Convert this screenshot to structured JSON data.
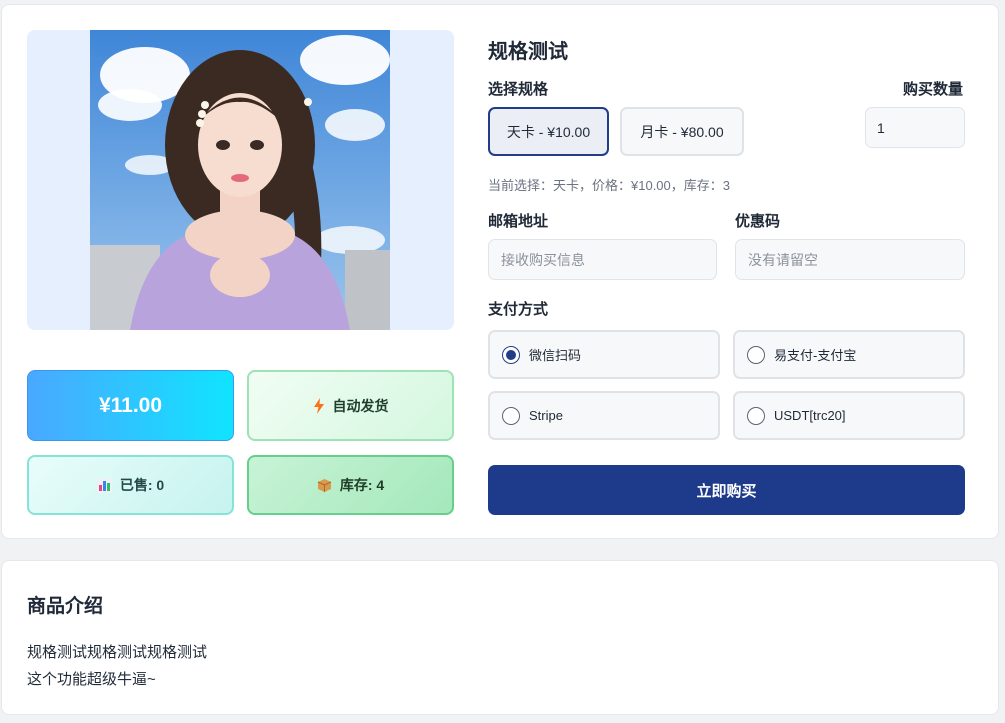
{
  "product": {
    "title": "规格测试",
    "image_icon": "product-photo",
    "price": "¥11.00",
    "delivery": {
      "icon": "lightning-icon",
      "label": "自动发货"
    },
    "sold": {
      "icon": "bar-chart-icon",
      "label": "已售: 0"
    },
    "stock": {
      "icon": "package-icon",
      "label": "库存: 4"
    }
  },
  "spec": {
    "label": "选择规格",
    "options": [
      {
        "label": "天卡 - ¥10.00",
        "selected": true
      },
      {
        "label": "月卡 - ¥80.00",
        "selected": false
      }
    ],
    "current": "当前选择：天卡，价格：¥10.00，库存：3"
  },
  "quantity": {
    "label": "购买数量",
    "value": "1"
  },
  "email": {
    "label": "邮箱地址",
    "placeholder": "接收购买信息"
  },
  "coupon": {
    "label": "优惠码",
    "placeholder": "没有请留空"
  },
  "payment": {
    "label": "支付方式",
    "methods": [
      {
        "label": "微信扫码",
        "selected": true
      },
      {
        "label": "易支付-支付宝",
        "selected": false
      },
      {
        "label": "Stripe",
        "selected": false
      },
      {
        "label": "USDT[trc20]",
        "selected": false
      }
    ]
  },
  "buy_button": "立即购买",
  "intro": {
    "title": "商品介绍",
    "lines": [
      "规格测试规格测试规格测试",
      "这个功能超级牛逼~"
    ]
  },
  "colors": {
    "primary": "#1e3a8a",
    "price_gradient_start": "#4aa8ff",
    "price_gradient_end": "#10e4ff",
    "delivery_icon": "#f97316"
  }
}
